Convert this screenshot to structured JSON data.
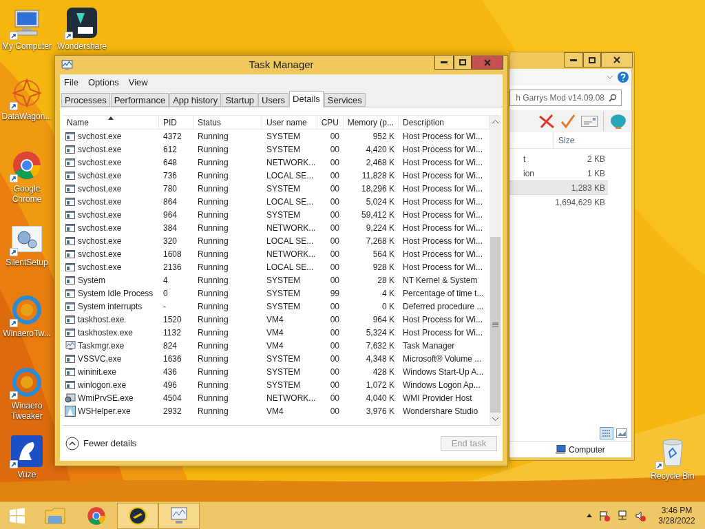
{
  "desktop_icons": [
    {
      "label": "My Computer",
      "kind": "computer"
    },
    {
      "label": "Wondershare",
      "kind": "wondershare"
    },
    {
      "label": "DataWagon...",
      "kind": "star"
    },
    {
      "label": "Google Chrome",
      "kind": "chrome"
    },
    {
      "label": "SilentSetup",
      "kind": "gears"
    },
    {
      "label": "WinaeroTw...",
      "kind": "winaero"
    },
    {
      "label": "Winaero Tweaker",
      "kind": "winaero"
    },
    {
      "label": "Vuze",
      "kind": "vuze"
    },
    {
      "label": "Recycle Bin",
      "kind": "bin"
    }
  ],
  "explorer": {
    "search_value": "h Garrys Mod v14.09.08",
    "column": "Size",
    "rows": [
      {
        "name": "t",
        "size": "2 KB",
        "selected": false
      },
      {
        "name": "ion",
        "size": "1 KB",
        "selected": false
      },
      {
        "name": "",
        "size": "1,283 KB",
        "selected": true
      },
      {
        "name": "",
        "size": "1,694,629 KB",
        "selected": false
      }
    ],
    "status": "Computer"
  },
  "window": {
    "title": "Task Manager"
  },
  "menu": [
    "File",
    "Options",
    "View"
  ],
  "tabs": [
    {
      "label": "Processes",
      "selected": false
    },
    {
      "label": "Performance",
      "selected": false
    },
    {
      "label": "App history",
      "selected": false
    },
    {
      "label": "Startup",
      "selected": false
    },
    {
      "label": "Users",
      "selected": false
    },
    {
      "label": "Details",
      "selected": true
    },
    {
      "label": "Services",
      "selected": false
    }
  ],
  "table": {
    "columns": [
      {
        "label": "Name",
        "sorted": true
      },
      {
        "label": "PID",
        "sorted": false
      },
      {
        "label": "Status",
        "sorted": false
      },
      {
        "label": "User name",
        "sorted": false
      },
      {
        "label": "CPU",
        "sorted": false
      },
      {
        "label": "Memory (p...",
        "sorted": false
      },
      {
        "label": "Description",
        "sorted": false
      }
    ],
    "rows": [
      {
        "kind": "app",
        "cells": [
          "svchost.exe",
          "4372",
          "Running",
          "SYSTEM",
          "00",
          "952 K",
          "Host Process for Wi..."
        ]
      },
      {
        "kind": "app",
        "cells": [
          "svchost.exe",
          "612",
          "Running",
          "SYSTEM",
          "00",
          "4,420 K",
          "Host Process for Wi..."
        ]
      },
      {
        "kind": "app",
        "cells": [
          "svchost.exe",
          "648",
          "Running",
          "NETWORK...",
          "00",
          "2,468 K",
          "Host Process for Wi..."
        ]
      },
      {
        "kind": "app",
        "cells": [
          "svchost.exe",
          "736",
          "Running",
          "LOCAL SE...",
          "00",
          "11,828 K",
          "Host Process for Wi..."
        ]
      },
      {
        "kind": "app",
        "cells": [
          "svchost.exe",
          "780",
          "Running",
          "SYSTEM",
          "00",
          "18,296 K",
          "Host Process for Wi..."
        ]
      },
      {
        "kind": "app",
        "cells": [
          "svchost.exe",
          "864",
          "Running",
          "LOCAL SE...",
          "00",
          "5,024 K",
          "Host Process for Wi..."
        ]
      },
      {
        "kind": "app",
        "cells": [
          "svchost.exe",
          "964",
          "Running",
          "SYSTEM",
          "00",
          "59,412 K",
          "Host Process for Wi..."
        ]
      },
      {
        "kind": "app",
        "cells": [
          "svchost.exe",
          "384",
          "Running",
          "NETWORK...",
          "00",
          "9,224 K",
          "Host Process for Wi..."
        ]
      },
      {
        "kind": "app",
        "cells": [
          "svchost.exe",
          "320",
          "Running",
          "LOCAL SE...",
          "00",
          "7,268 K",
          "Host Process for Wi..."
        ]
      },
      {
        "kind": "app",
        "cells": [
          "svchost.exe",
          "1608",
          "Running",
          "NETWORK...",
          "00",
          "564 K",
          "Host Process for Wi..."
        ]
      },
      {
        "kind": "app",
        "cells": [
          "svchost.exe",
          "2136",
          "Running",
          "LOCAL SE...",
          "00",
          "928 K",
          "Host Process for Wi..."
        ]
      },
      {
        "kind": "app",
        "cells": [
          "System",
          "4",
          "Running",
          "SYSTEM",
          "00",
          "28 K",
          "NT Kernel & System"
        ]
      },
      {
        "kind": "app",
        "cells": [
          "System Idle Process",
          "0",
          "Running",
          "SYSTEM",
          "99",
          "4 K",
          "Percentage of time t..."
        ]
      },
      {
        "kind": "app",
        "cells": [
          "System interrupts",
          "-",
          "Running",
          "SYSTEM",
          "00",
          "0 K",
          "Deferred procedure ..."
        ]
      },
      {
        "kind": "app",
        "cells": [
          "taskhost.exe",
          "1520",
          "Running",
          "VM4",
          "00",
          "964 K",
          "Host Process for Wi..."
        ]
      },
      {
        "kind": "app",
        "cells": [
          "taskhostex.exe",
          "1132",
          "Running",
          "VM4",
          "00",
          "5,324 K",
          "Host Process for Wi..."
        ]
      },
      {
        "kind": "monitor",
        "cells": [
          "Taskmgr.exe",
          "824",
          "Running",
          "VM4",
          "00",
          "7,632 K",
          "Task Manager"
        ]
      },
      {
        "kind": "app",
        "cells": [
          "VSSVC.exe",
          "1636",
          "Running",
          "SYSTEM",
          "00",
          "4,348 K",
          "Microsoft® Volume ..."
        ]
      },
      {
        "kind": "app",
        "cells": [
          "wininit.exe",
          "436",
          "Running",
          "SYSTEM",
          "00",
          "428 K",
          "Windows Start-Up A..."
        ]
      },
      {
        "kind": "app",
        "cells": [
          "winlogon.exe",
          "496",
          "Running",
          "SYSTEM",
          "00",
          "1,072 K",
          "Windows Logon Ap..."
        ]
      },
      {
        "kind": "service",
        "cells": [
          "WmiPrvSE.exe",
          "4504",
          "Running",
          "NETWORK...",
          "00",
          "4,040 K",
          "WMI Provider Host"
        ]
      },
      {
        "kind": "helper",
        "cells": [
          "WSHelper.exe",
          "2932",
          "Running",
          "VM4",
          "00",
          "3,976 K",
          "Wondershare Studio"
        ]
      }
    ]
  },
  "footer": {
    "toggle": "Fewer details",
    "button": {
      "label": "End task",
      "disabled": true
    }
  },
  "taskbar": {
    "items": [
      {
        "kind": "start",
        "active": false
      },
      {
        "kind": "folder",
        "active": false
      },
      {
        "kind": "chrome",
        "active": false
      },
      {
        "kind": "wrench",
        "active": true
      },
      {
        "kind": "monitor",
        "active": true
      }
    ],
    "time": "3:46 PM",
    "date": "3/28/2022"
  }
}
